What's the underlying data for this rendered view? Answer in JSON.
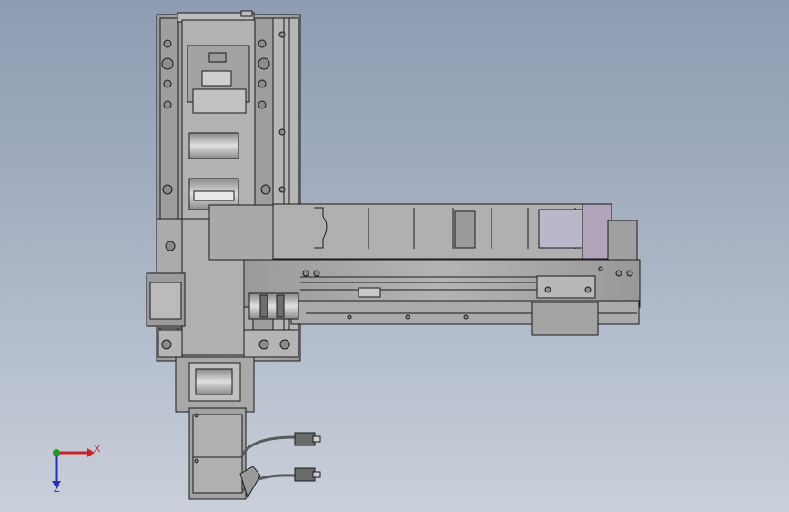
{
  "viewport": {
    "background_top": "#8e9bb1",
    "background_bottom": "#c9d0da"
  },
  "model": {
    "part_fill": "#a6a6a6",
    "part_fill_light": "#c4c4c4",
    "part_fill_dark": "#7d7d7d",
    "edge_color": "#1a1a1a"
  },
  "triad": {
    "x_label": "X",
    "z_label": "Z",
    "x_color": "#d02020",
    "y_color": "#1f9a1f",
    "z_color": "#2030c0"
  }
}
